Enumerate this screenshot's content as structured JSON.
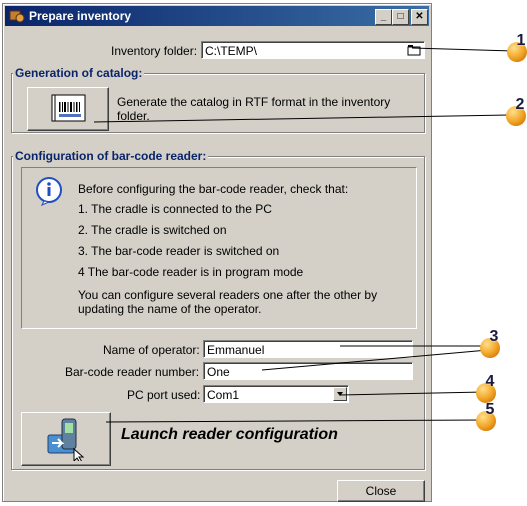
{
  "window": {
    "title": "Prepare inventory"
  },
  "inventory_folder": {
    "label": "Inventory folder:",
    "value": "C:\\TEMP\\"
  },
  "catalog": {
    "group_title": "Generation of catalog:",
    "description": "Generate the catalog in RTF format in the inventory folder."
  },
  "config": {
    "group_title": "Configuration of bar-code reader:",
    "info_lines": [
      "Before configuring the bar-code reader, check that:",
      "1. The cradle is connected to the PC",
      "2. The cradle is switched on",
      "3. The bar-code reader is switched on",
      "4 The bar-code reader is in program mode",
      "You can configure several readers one after the other by updating the name of the operator."
    ],
    "operator_label": "Name of operator:",
    "operator_value": "Emmanuel",
    "reader_number_label": "Bar-code reader number:",
    "reader_number_value": "One",
    "pc_port_label": "PC port used:",
    "pc_port_value": "Com1"
  },
  "launch_label": "Launch reader configuration",
  "close_label": "Close",
  "callouts": [
    "1",
    "2",
    "3",
    "4",
    "5"
  ],
  "colors": {
    "group_title": "#0a246a",
    "titlebar": "#0a246a",
    "callout": "#f0a020"
  }
}
